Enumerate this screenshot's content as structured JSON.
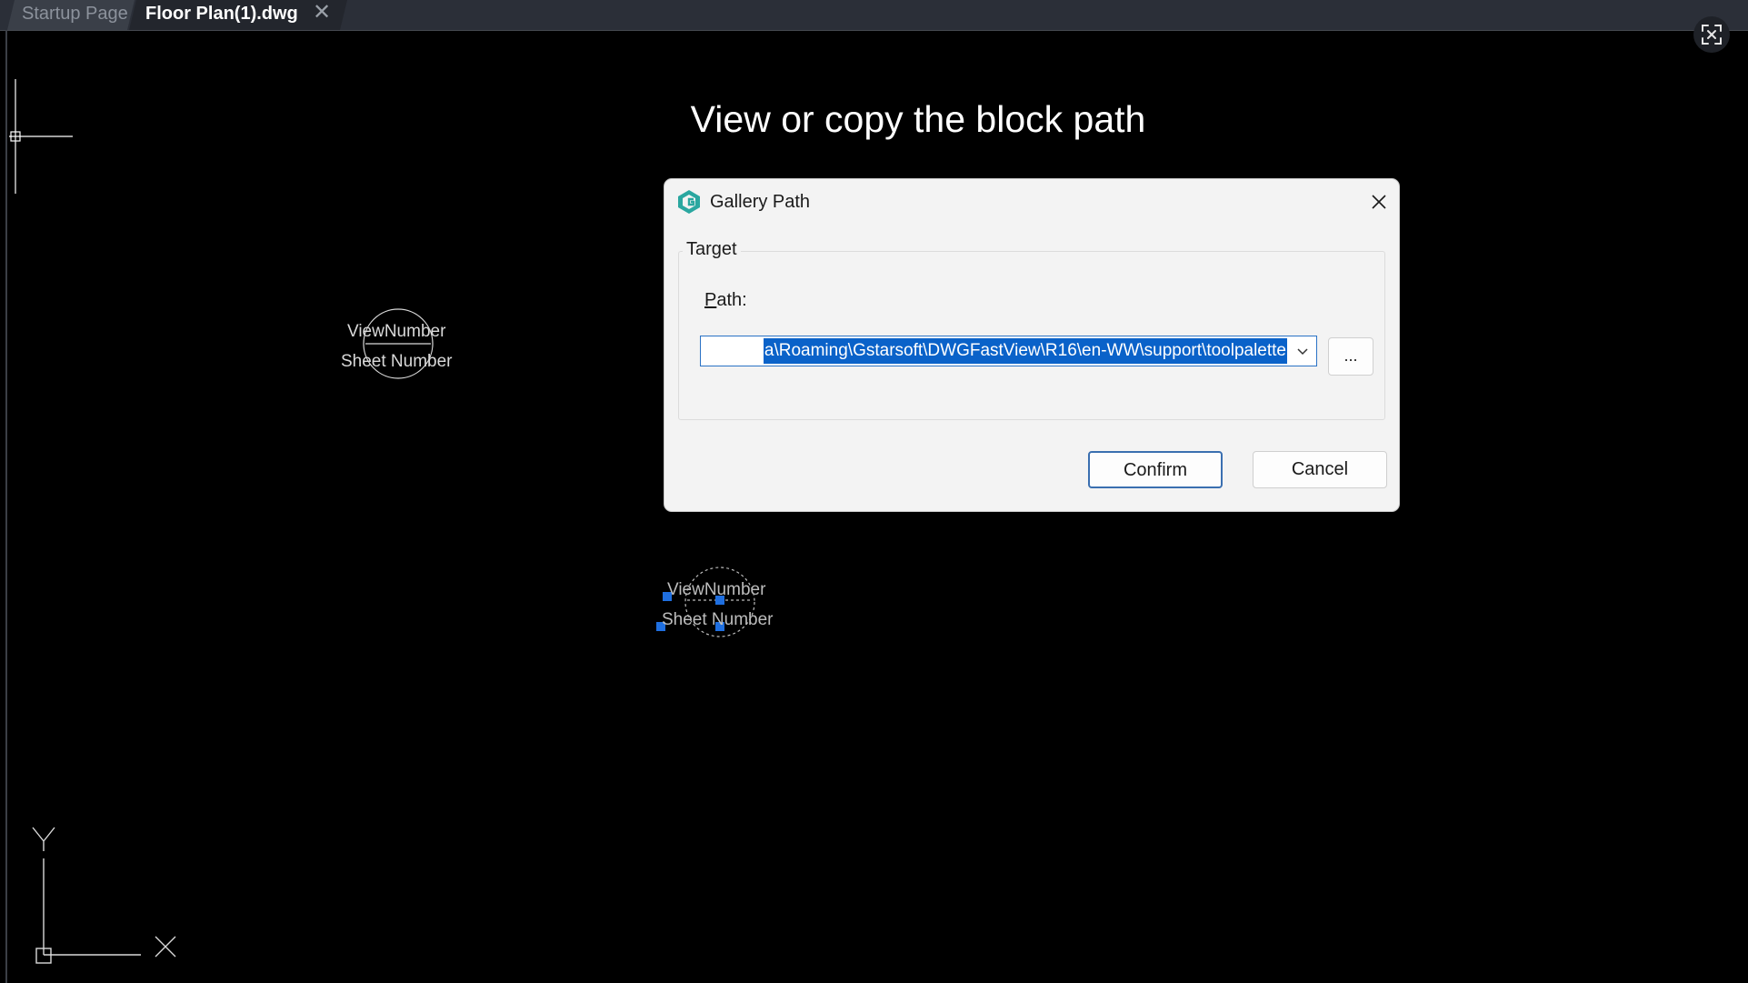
{
  "tabs": {
    "startup": "Startup Page",
    "active": "Floor Plan(1).dwg",
    "close_glyph": "✕"
  },
  "canvas": {
    "headline": "View or copy the block path",
    "block1": {
      "top": "ViewNumber",
      "bottom": "Sheet Number"
    },
    "block2": {
      "top": "ViewNumber",
      "bottom": "Sheet Number"
    },
    "ucs": {
      "y_label": "Y",
      "x_label": "X"
    },
    "selection_grip_color": "#1f6fe0"
  },
  "dialog": {
    "title": "Gallery Path",
    "group_label": "Target",
    "path_label_prefix": "P",
    "path_label_rest": "ath:",
    "path_value": "a\\Roaming\\Gstarsoft\\DWGFastView\\R16\\en-WW\\support\\toolpalette",
    "browse_label": "...",
    "confirm_label": "Confirm",
    "cancel_label": "Cancel",
    "icon": "gstarcad-logo-icon",
    "accent_color": "#0a62c9"
  }
}
